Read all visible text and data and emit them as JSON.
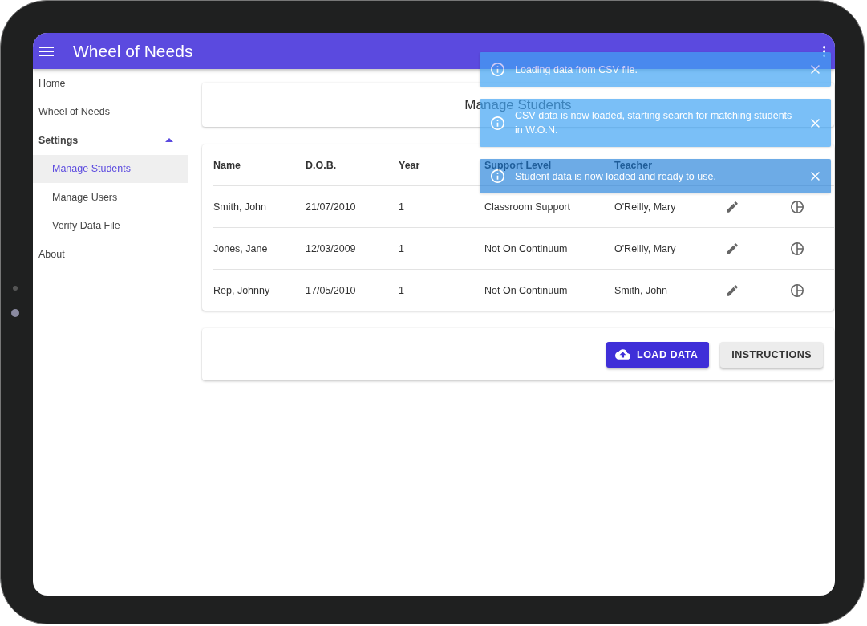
{
  "app_bar": {
    "title": "Wheel of Needs"
  },
  "sidebar": {
    "items": [
      {
        "label": "Home",
        "selected": false
      },
      {
        "label": "Wheel of Needs",
        "selected": false
      },
      {
        "label": "Settings",
        "selected": false,
        "expanded": true,
        "children": [
          {
            "label": "Manage Students",
            "selected": true
          },
          {
            "label": "Manage Users",
            "selected": false
          },
          {
            "label": "Verify Data File",
            "selected": false
          }
        ]
      },
      {
        "label": "About",
        "selected": false
      }
    ]
  },
  "page_title": "Manage Students",
  "table": {
    "columns": [
      "Name",
      "D.O.B.",
      "Year",
      "Support Level",
      "Teacher"
    ],
    "rows": [
      {
        "cells": [
          "Smith, John",
          "21/07/2010",
          "1",
          "Classroom Support",
          "O'Reilly, Mary"
        ]
      },
      {
        "cells": [
          "Jones, Jane",
          "12/03/2009",
          "1",
          "Not On Continuum",
          "O'Reilly, Mary"
        ]
      },
      {
        "cells": [
          "Rep, Johnny",
          "17/05/2010",
          "1",
          "Not On Continuum",
          "Smith, John"
        ]
      }
    ]
  },
  "buttons": [
    {
      "label": "LOAD DATA",
      "kind": "primary"
    },
    {
      "label": "INSTRUCTIONS",
      "kind": "secondary"
    }
  ],
  "toasts": [
    {
      "message": "Loading data from CSV file.",
      "faded": true
    },
    {
      "message": "CSV data is now loaded, starting search for matching students in W.O.N.",
      "faded": true
    },
    {
      "message": "Student data is now loaded and ready to use.",
      "faded": false
    }
  ]
}
